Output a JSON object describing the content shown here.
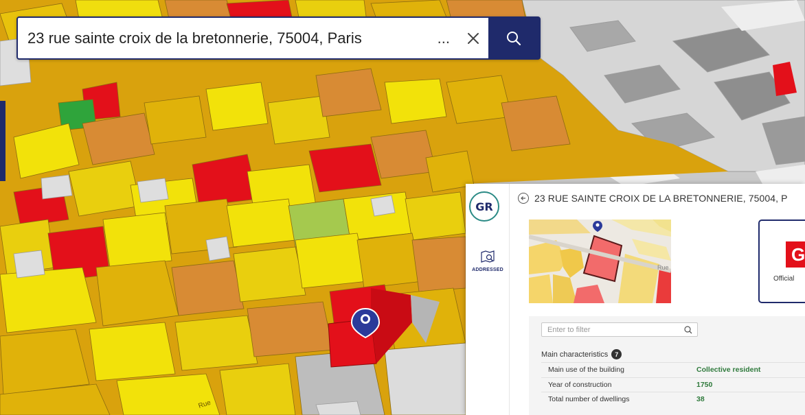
{
  "search": {
    "query": "23 rue sainte croix de la bretonnerie, 75004, Paris",
    "overflow": "...",
    "clear_icon": "close-icon",
    "submit_icon": "search-icon"
  },
  "map": {
    "view": "3d-buildings",
    "palette": {
      "gray": "#bdbdbd",
      "light_gray": "#dcdcdc",
      "yellow": "#f2e20a",
      "amber": "#e0b20a",
      "orange": "#d98b33",
      "red": "#e8231b",
      "light_green": "#a5c94e",
      "green": "#2fa43b"
    },
    "marker_icon": "map-pin-icon",
    "street_label": "Rue"
  },
  "panel": {
    "logo_text": "GR",
    "rail_items": [
      {
        "label": "ADDRESSED",
        "icon": "map-search-icon"
      }
    ],
    "title": "23 RUE SAINTE CROIX DE LA BRETONNERIE, 75004, P",
    "back_icon": "arrow-left-icon",
    "minimap_street_label": "Rue",
    "card": {
      "mark_text": "G",
      "caption": "Official"
    },
    "filter": {
      "placeholder": "Enter to filter",
      "icon": "search-icon"
    },
    "section": {
      "title": "Main characteristics",
      "count": "7",
      "rows": [
        {
          "label": "Main use of the building",
          "value": "Collective resident"
        },
        {
          "label": "Year of construction",
          "value": "1750"
        },
        {
          "label": "Total number of dwellings",
          "value": "38"
        }
      ]
    }
  }
}
